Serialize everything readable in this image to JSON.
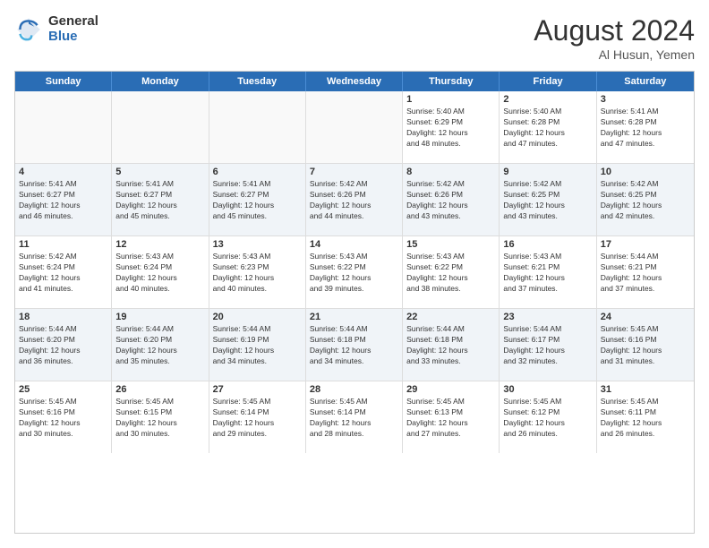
{
  "logo": {
    "general": "General",
    "blue": "Blue"
  },
  "title": "August 2024",
  "location": "Al Husun, Yemen",
  "days": [
    "Sunday",
    "Monday",
    "Tuesday",
    "Wednesday",
    "Thursday",
    "Friday",
    "Saturday"
  ],
  "rows": [
    [
      {
        "day": "",
        "text": "",
        "empty": true
      },
      {
        "day": "",
        "text": "",
        "empty": true
      },
      {
        "day": "",
        "text": "",
        "empty": true
      },
      {
        "day": "",
        "text": "",
        "empty": true
      },
      {
        "day": "1",
        "text": "Sunrise: 5:40 AM\nSunset: 6:29 PM\nDaylight: 12 hours\nand 48 minutes."
      },
      {
        "day": "2",
        "text": "Sunrise: 5:40 AM\nSunset: 6:28 PM\nDaylight: 12 hours\nand 47 minutes."
      },
      {
        "day": "3",
        "text": "Sunrise: 5:41 AM\nSunset: 6:28 PM\nDaylight: 12 hours\nand 47 minutes."
      }
    ],
    [
      {
        "day": "4",
        "text": "Sunrise: 5:41 AM\nSunset: 6:27 PM\nDaylight: 12 hours\nand 46 minutes."
      },
      {
        "day": "5",
        "text": "Sunrise: 5:41 AM\nSunset: 6:27 PM\nDaylight: 12 hours\nand 45 minutes."
      },
      {
        "day": "6",
        "text": "Sunrise: 5:41 AM\nSunset: 6:27 PM\nDaylight: 12 hours\nand 45 minutes."
      },
      {
        "day": "7",
        "text": "Sunrise: 5:42 AM\nSunset: 6:26 PM\nDaylight: 12 hours\nand 44 minutes."
      },
      {
        "day": "8",
        "text": "Sunrise: 5:42 AM\nSunset: 6:26 PM\nDaylight: 12 hours\nand 43 minutes."
      },
      {
        "day": "9",
        "text": "Sunrise: 5:42 AM\nSunset: 6:25 PM\nDaylight: 12 hours\nand 43 minutes."
      },
      {
        "day": "10",
        "text": "Sunrise: 5:42 AM\nSunset: 6:25 PM\nDaylight: 12 hours\nand 42 minutes."
      }
    ],
    [
      {
        "day": "11",
        "text": "Sunrise: 5:42 AM\nSunset: 6:24 PM\nDaylight: 12 hours\nand 41 minutes."
      },
      {
        "day": "12",
        "text": "Sunrise: 5:43 AM\nSunset: 6:24 PM\nDaylight: 12 hours\nand 40 minutes."
      },
      {
        "day": "13",
        "text": "Sunrise: 5:43 AM\nSunset: 6:23 PM\nDaylight: 12 hours\nand 40 minutes."
      },
      {
        "day": "14",
        "text": "Sunrise: 5:43 AM\nSunset: 6:22 PM\nDaylight: 12 hours\nand 39 minutes."
      },
      {
        "day": "15",
        "text": "Sunrise: 5:43 AM\nSunset: 6:22 PM\nDaylight: 12 hours\nand 38 minutes."
      },
      {
        "day": "16",
        "text": "Sunrise: 5:43 AM\nSunset: 6:21 PM\nDaylight: 12 hours\nand 37 minutes."
      },
      {
        "day": "17",
        "text": "Sunrise: 5:44 AM\nSunset: 6:21 PM\nDaylight: 12 hours\nand 37 minutes."
      }
    ],
    [
      {
        "day": "18",
        "text": "Sunrise: 5:44 AM\nSunset: 6:20 PM\nDaylight: 12 hours\nand 36 minutes."
      },
      {
        "day": "19",
        "text": "Sunrise: 5:44 AM\nSunset: 6:20 PM\nDaylight: 12 hours\nand 35 minutes."
      },
      {
        "day": "20",
        "text": "Sunrise: 5:44 AM\nSunset: 6:19 PM\nDaylight: 12 hours\nand 34 minutes."
      },
      {
        "day": "21",
        "text": "Sunrise: 5:44 AM\nSunset: 6:18 PM\nDaylight: 12 hours\nand 34 minutes."
      },
      {
        "day": "22",
        "text": "Sunrise: 5:44 AM\nSunset: 6:18 PM\nDaylight: 12 hours\nand 33 minutes."
      },
      {
        "day": "23",
        "text": "Sunrise: 5:44 AM\nSunset: 6:17 PM\nDaylight: 12 hours\nand 32 minutes."
      },
      {
        "day": "24",
        "text": "Sunrise: 5:45 AM\nSunset: 6:16 PM\nDaylight: 12 hours\nand 31 minutes."
      }
    ],
    [
      {
        "day": "25",
        "text": "Sunrise: 5:45 AM\nSunset: 6:16 PM\nDaylight: 12 hours\nand 30 minutes."
      },
      {
        "day": "26",
        "text": "Sunrise: 5:45 AM\nSunset: 6:15 PM\nDaylight: 12 hours\nand 30 minutes."
      },
      {
        "day": "27",
        "text": "Sunrise: 5:45 AM\nSunset: 6:14 PM\nDaylight: 12 hours\nand 29 minutes."
      },
      {
        "day": "28",
        "text": "Sunrise: 5:45 AM\nSunset: 6:14 PM\nDaylight: 12 hours\nand 28 minutes."
      },
      {
        "day": "29",
        "text": "Sunrise: 5:45 AM\nSunset: 6:13 PM\nDaylight: 12 hours\nand 27 minutes."
      },
      {
        "day": "30",
        "text": "Sunrise: 5:45 AM\nSunset: 6:12 PM\nDaylight: 12 hours\nand 26 minutes."
      },
      {
        "day": "31",
        "text": "Sunrise: 5:45 AM\nSunset: 6:11 PM\nDaylight: 12 hours\nand 26 minutes."
      }
    ]
  ]
}
